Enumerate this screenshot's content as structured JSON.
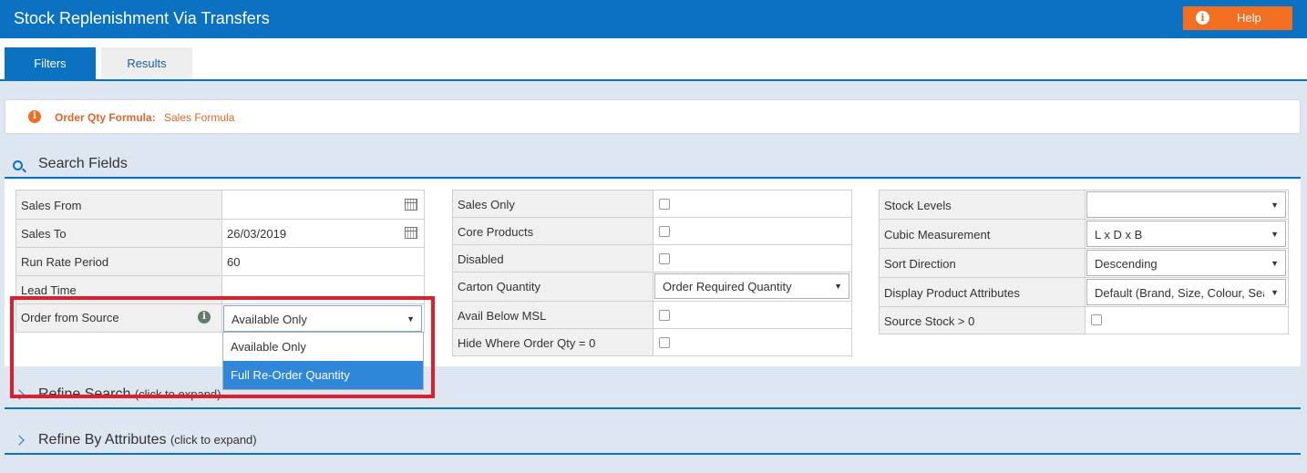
{
  "header": {
    "title": "Stock Replenishment Via Transfers",
    "help_label": "Help"
  },
  "tabs": [
    {
      "label": "Filters",
      "active": true
    },
    {
      "label": "Results",
      "active": false
    }
  ],
  "info": {
    "label": "Order Qty Formula:",
    "value": "Sales Formula"
  },
  "sections": {
    "search": {
      "title": "Search Fields"
    },
    "refine_search": {
      "title": "Refine Search",
      "hint": "(click to expand)"
    },
    "refine_attrs": {
      "title": "Refine By Attributes",
      "hint": "(click to expand)"
    }
  },
  "left_fields": [
    {
      "label": "Sales From",
      "value": ""
    },
    {
      "label": "Sales To",
      "value": "26/03/2019"
    },
    {
      "label": "Run Rate Period",
      "value": "60"
    },
    {
      "label": "Lead Time",
      "value": ""
    },
    {
      "label": "Order from Source",
      "value": "Available Only"
    }
  ],
  "dropdown_options": [
    "Available Only",
    "Full Re-Order Quantity"
  ],
  "middle_fields": [
    {
      "label": "Sales Only"
    },
    {
      "label": "Core Products"
    },
    {
      "label": "Disabled"
    },
    {
      "label": "Carton Quantity",
      "value": "Order Required Quantity"
    },
    {
      "label": "Avail Below MSL"
    },
    {
      "label": "Hide Where Order Qty = 0"
    }
  ],
  "right_fields": [
    {
      "label": "Stock Levels",
      "value": ""
    },
    {
      "label": "Cubic Measurement",
      "value": "L x D x B"
    },
    {
      "label": "Sort Direction",
      "value": "Descending"
    },
    {
      "label": "Display Product Attributes",
      "value": "Default (Brand, Size, Colour, Sea"
    },
    {
      "label": "Source Stock > 0"
    }
  ],
  "colors": {
    "brand_blue": "#0a72c0",
    "help_orange": "#f26e21",
    "highlight_red": "#e21d2b",
    "option_hover": "#2e87d8"
  }
}
